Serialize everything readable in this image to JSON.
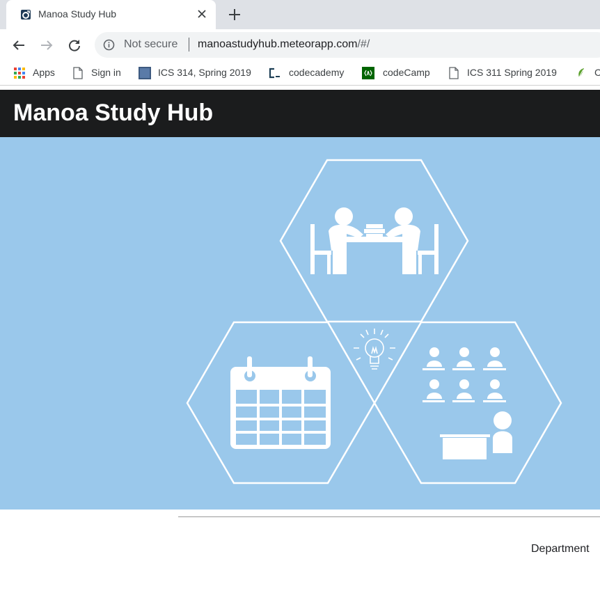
{
  "browser": {
    "tab": {
      "title": "Manoa Study Hub"
    },
    "omnibox": {
      "security": "Not secure",
      "url_host": "manoastudyhub.meteorapp.com",
      "url_path": "/#/"
    },
    "bookmarks": [
      {
        "label": "Apps",
        "icon": "apps-grid-icon"
      },
      {
        "label": "Sign in",
        "icon": "page-icon"
      },
      {
        "label": "ICS 314, Spring 2019",
        "icon": "square-favicon-icon"
      },
      {
        "label": "codecademy",
        "icon": "codecademy-icon"
      },
      {
        "label": "codeCamp",
        "icon": "codecamp-icon"
      },
      {
        "label": "ICS 311 Spring 2019",
        "icon": "page-icon"
      },
      {
        "label": "C",
        "icon": "leaf-icon"
      }
    ]
  },
  "page": {
    "brand": "Manoa Study Hub",
    "hero": {
      "background": "#9ac8eb",
      "icons": [
        "study-table-icon",
        "lightbulb-icon",
        "calendar-icon",
        "classroom-icon"
      ]
    },
    "footer": {
      "text": "Department"
    }
  },
  "colors": {
    "navbar": "#1b1c1d",
    "hero": "#9ac8eb"
  }
}
